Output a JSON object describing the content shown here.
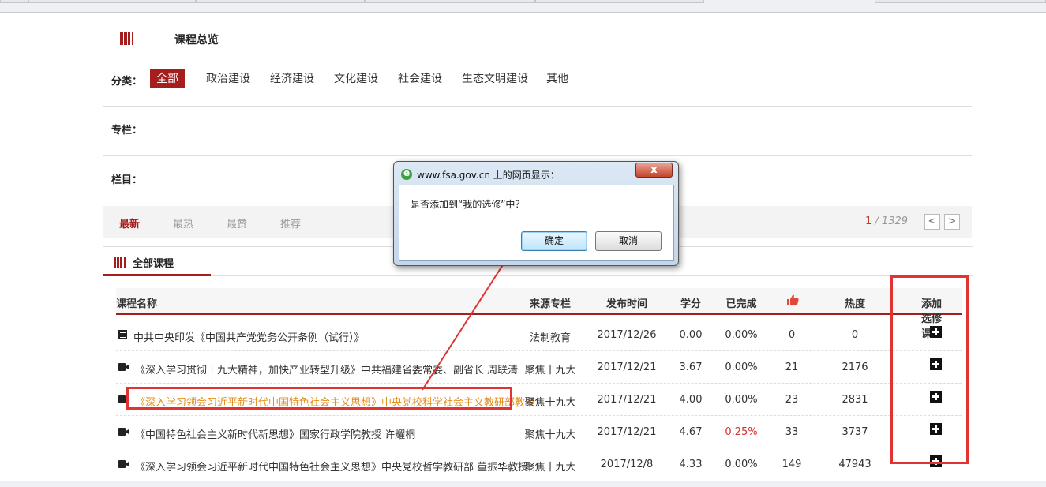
{
  "section": {
    "title": "课程总览"
  },
  "filters": {
    "category_label": "分类：",
    "categories": [
      "全部",
      "政治建设",
      "经济建设",
      "文化建设",
      "社会建设",
      "生态文明建设",
      "其他"
    ],
    "column_label": "专栏：",
    "lanmu_label": "栏目："
  },
  "sortbar": {
    "tabs": [
      "最新",
      "最热",
      "最赞",
      "推荐"
    ],
    "page_current": "1",
    "page_total": " / 1329",
    "prev": "<",
    "next": ">"
  },
  "panel": {
    "title": "全部课程"
  },
  "table": {
    "headers": {
      "name": "课程名称",
      "source": "来源专栏",
      "date": "发布时间",
      "credit": "学分",
      "done": "已完成",
      "likes_icon": "thumbs-up-icon",
      "heat": "热度",
      "add": "添加选修课"
    },
    "rows": [
      {
        "type": "document",
        "title": "中共中央印发《中国共产党党务公开条例（试行）》",
        "source": "法制教育",
        "date": "2017/12/26",
        "credit": "0.00",
        "done": "0.00%",
        "likes": "0",
        "heat": "0"
      },
      {
        "type": "video",
        "title": "《深入学习贯彻十九大精神，加快产业转型升级》中共福建省委常委、副省长 周联清",
        "source": "聚焦十九大",
        "date": "2017/12/21",
        "credit": "3.67",
        "done": "0.00%",
        "likes": "21",
        "heat": "2176"
      },
      {
        "type": "video",
        "title": "《深入学习领会习近平新时代中国特色社会主义思想》中央党校科学社会主义教研部教授",
        "source": "聚焦十九大",
        "date": "2017/12/21",
        "credit": "4.00",
        "done": "0.00%",
        "likes": "23",
        "heat": "2831"
      },
      {
        "type": "video",
        "title": "《中国特色社会主义新时代新思想》国家行政学院教授 许耀桐",
        "source": "聚焦十九大",
        "date": "2017/12/21",
        "credit": "4.67",
        "done": "0.25%",
        "likes": "33",
        "heat": "3737"
      },
      {
        "type": "video",
        "title": "《深入学习领会习近平新时代中国特色社会主义思想》中央党校哲学教研部 董振华教授",
        "source": "聚焦十九大",
        "date": "2017/12/8",
        "credit": "4.33",
        "done": "0.00%",
        "likes": "149",
        "heat": "47943"
      }
    ]
  },
  "dialog": {
    "title": "www.fsa.gov.cn 上的网页显示：",
    "message": "是否添加到“我的选修”中？",
    "ok": "确定",
    "cancel": "取消",
    "close": "x"
  },
  "colors": {
    "brand": "#a51d1d",
    "highlight": "#e58e1a",
    "annotation": "#e23333"
  }
}
